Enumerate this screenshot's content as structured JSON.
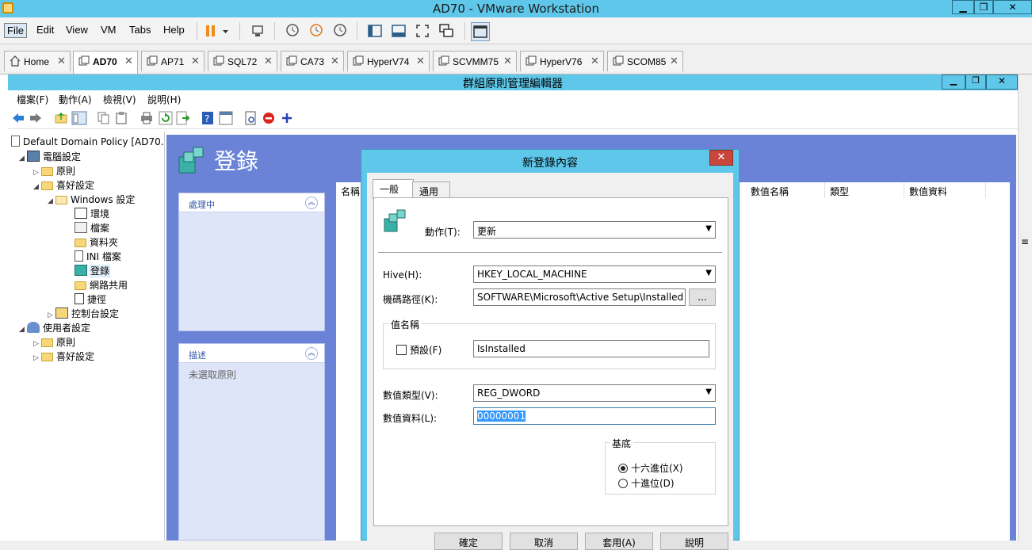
{
  "window": {
    "title": "AD70 - VMware Workstation"
  },
  "menu": [
    "File",
    "Edit",
    "View",
    "VM",
    "Tabs",
    "Help"
  ],
  "tabs": [
    {
      "label": "Home"
    },
    {
      "label": "AD70"
    },
    {
      "label": "AP71"
    },
    {
      "label": "SQL72"
    },
    {
      "label": "CA73"
    },
    {
      "label": "HyperV74"
    },
    {
      "label": "SCVMM75"
    },
    {
      "label": "HyperV76"
    },
    {
      "label": "SCOM85"
    }
  ],
  "close_glyph": "✕",
  "gpme": {
    "title": "群組原則管理編輯器",
    "menu": [
      "檔案(F)",
      "動作(A)",
      "檢視(V)",
      "說明(H)"
    ]
  },
  "tree": {
    "root": "Default Domain Policy [AD70.",
    "computer": "電腦設定",
    "policies": "原則",
    "preferences": "喜好設定",
    "windows_settings": "Windows 設定",
    "environment": "環境",
    "files": "檔案",
    "folders": "資料夾",
    "ini_files": "INI 檔案",
    "registry": "登錄",
    "network_shares": "網路共用",
    "shortcuts": "捷徑",
    "control_panel": "控制台設定",
    "user": "使用者設定",
    "user_policies": "原則",
    "user_preferences": "喜好設定"
  },
  "content": {
    "heading": "登錄",
    "panel_processing": "處理中",
    "panel_description": "描述",
    "no_policy": "未選取原則",
    "col_name": "名稱",
    "col_value_name": "數值名稱",
    "col_type": "類型",
    "col_value_data": "數值資料"
  },
  "dialog": {
    "title": "新登錄內容",
    "tab_general": "一般",
    "tab_common": "通用",
    "action_label": "動作(T):",
    "action_value": "更新",
    "hive_label": "Hive(H):",
    "hive_value": "HKEY_LOCAL_MACHINE",
    "keypath_label": "機碼路徑(K):",
    "keypath_value": "SOFTWARE\\Microsoft\\Active Setup\\Installed C",
    "browse_label": "...",
    "value_name_group": "值名稱",
    "default_label": "預設(F)",
    "value_name": "IsInstalled",
    "value_type_label": "數值類型(V):",
    "value_type": "REG_DWORD",
    "value_data_label": "數值資料(L):",
    "value_data": "00000001",
    "base_group": "基底",
    "hex_label": "十六進位(X)",
    "dec_label": "十進位(D)",
    "ok_label": "確定",
    "cancel_label": "取消",
    "apply_label": "套用(A)",
    "help_label": "說明"
  },
  "colors": {
    "vm_title": "#5fc8ea",
    "content_bg": "#6a83d7",
    "panel_bg": "#dfe5f8"
  }
}
